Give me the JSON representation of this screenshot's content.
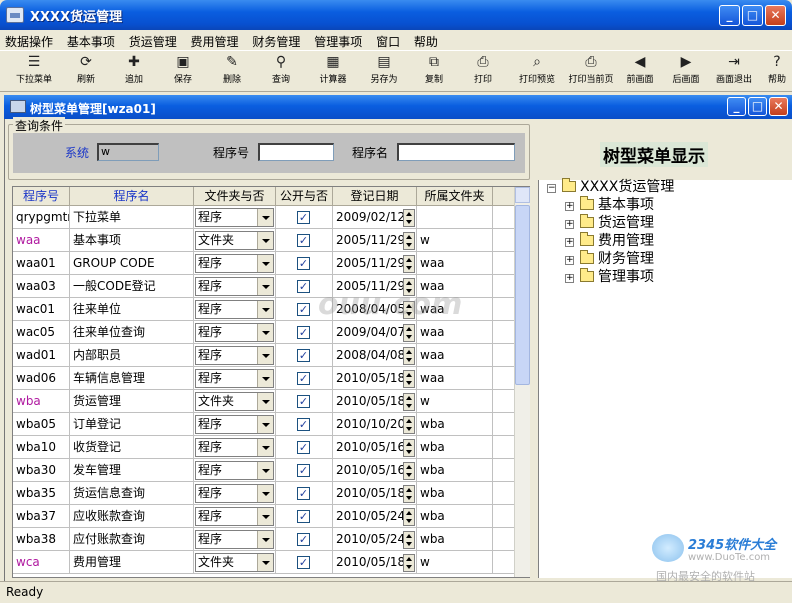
{
  "window": {
    "title": "XXXX货运管理"
  },
  "menu": [
    "数据操作",
    "基本事项",
    "货运管理",
    "费用管理",
    "财务管理",
    "管理事项",
    "窗口",
    "帮助"
  ],
  "toolbar": [
    {
      "label": "下拉菜单",
      "icon": "dropdown-menu-icon",
      "glyph": "☰"
    },
    {
      "label": "刷新",
      "icon": "refresh-icon",
      "glyph": "⟳"
    },
    {
      "label": "追加",
      "icon": "append-icon",
      "glyph": "✚"
    },
    {
      "label": "保存",
      "icon": "save-icon",
      "glyph": "▣"
    },
    {
      "label": "删除",
      "icon": "delete-icon",
      "glyph": "✎"
    },
    {
      "label": "查询",
      "icon": "search-icon",
      "glyph": "⚲"
    },
    {
      "label": "计算器",
      "icon": "calculator-icon",
      "glyph": "▦"
    },
    {
      "label": "另存为",
      "icon": "save-as-icon",
      "glyph": "▤"
    },
    {
      "label": "复制",
      "icon": "copy-icon",
      "glyph": "⧉"
    },
    {
      "label": "打印",
      "icon": "print-icon",
      "glyph": "⎙"
    },
    {
      "label": "打印预览",
      "icon": "print-preview-icon",
      "glyph": "⌕"
    },
    {
      "label": "打印当前页",
      "icon": "print-page-icon",
      "glyph": "⎙"
    },
    {
      "label": "前画面",
      "icon": "prev-screen-icon",
      "glyph": "◀"
    },
    {
      "label": "后画面",
      "icon": "next-screen-icon",
      "glyph": "▶"
    },
    {
      "label": "画面退出",
      "icon": "exit-screen-icon",
      "glyph": "⇥"
    },
    {
      "label": "帮助",
      "icon": "help-icon",
      "glyph": "?"
    }
  ],
  "inner_window": {
    "title": "树型菜单管理[wza01]"
  },
  "query": {
    "legend": "查询条件",
    "system_label": "系统",
    "system_value": "w",
    "program_no_label": "程序号",
    "program_no_value": "",
    "program_name_label": "程序名",
    "program_name_value": ""
  },
  "grid": {
    "headers": [
      "程序号",
      "程序名",
      "文件夹与否",
      "公开与否",
      "登记日期",
      "所属文件夹"
    ],
    "rows": [
      {
        "code": "qrypgmtr",
        "name": "下拉菜单",
        "type": "程序",
        "public": true,
        "date": "2009/02/12",
        "parent": "",
        "folder": false
      },
      {
        "code": "waa",
        "name": "基本事项",
        "type": "文件夹",
        "public": true,
        "date": "2005/11/29",
        "parent": "w",
        "folder": true
      },
      {
        "code": "waa01",
        "name": "GROUP CODE",
        "type": "程序",
        "public": true,
        "date": "2005/11/29",
        "parent": "waa",
        "folder": false
      },
      {
        "code": "waa03",
        "name": "一般CODE登记",
        "type": "程序",
        "public": true,
        "date": "2005/11/29",
        "parent": "waa",
        "folder": false
      },
      {
        "code": "wac01",
        "name": "往来单位",
        "type": "程序",
        "public": true,
        "date": "2008/04/05",
        "parent": "waa",
        "folder": false
      },
      {
        "code": "wac05",
        "name": "往来单位查询",
        "type": "程序",
        "public": true,
        "date": "2009/04/07",
        "parent": "waa",
        "folder": false
      },
      {
        "code": "wad01",
        "name": "内部职员",
        "type": "程序",
        "public": true,
        "date": "2008/04/08",
        "parent": "waa",
        "folder": false
      },
      {
        "code": "wad06",
        "name": "车辆信息管理",
        "type": "程序",
        "public": true,
        "date": "2010/05/18",
        "parent": "waa",
        "folder": false
      },
      {
        "code": "wba",
        "name": "货运管理",
        "type": "文件夹",
        "public": true,
        "date": "2010/05/18",
        "parent": "w",
        "folder": true
      },
      {
        "code": "wba05",
        "name": "订单登记",
        "type": "程序",
        "public": true,
        "date": "2010/10/20",
        "parent": "wba",
        "folder": false
      },
      {
        "code": "wba10",
        "name": "收货登记",
        "type": "程序",
        "public": true,
        "date": "2010/05/16",
        "parent": "wba",
        "folder": false
      },
      {
        "code": "wba30",
        "name": "发车管理",
        "type": "程序",
        "public": true,
        "date": "2010/05/16",
        "parent": "wba",
        "folder": false
      },
      {
        "code": "wba35",
        "name": "货运信息查询",
        "type": "程序",
        "public": true,
        "date": "2010/05/18",
        "parent": "wba",
        "folder": false
      },
      {
        "code": "wba37",
        "name": "应收账款查询",
        "type": "程序",
        "public": true,
        "date": "2010/05/24",
        "parent": "wba",
        "folder": false
      },
      {
        "code": "wba38",
        "name": "应付账款查询",
        "type": "程序",
        "public": true,
        "date": "2010/05/24",
        "parent": "wba",
        "folder": false
      },
      {
        "code": "wca",
        "name": "费用管理",
        "type": "文件夹",
        "public": true,
        "date": "2010/05/18",
        "parent": "w",
        "folder": true
      }
    ]
  },
  "tree": {
    "header": "树型菜单显示",
    "root": "XXXX货运管理",
    "children": [
      "基本事项",
      "货运管理",
      "费用管理",
      "财务管理",
      "管理事项"
    ]
  },
  "status": "Ready",
  "watermark": {
    "text": "ouu.com",
    "brand": "2345软件大全",
    "url": "www.DuoTe.com",
    "slogan": "国内最安全的软件站"
  },
  "colors": {
    "titlebar": "#0a5ee0",
    "folder_code": "#b01aa0",
    "header_text": "#1a36c8"
  }
}
